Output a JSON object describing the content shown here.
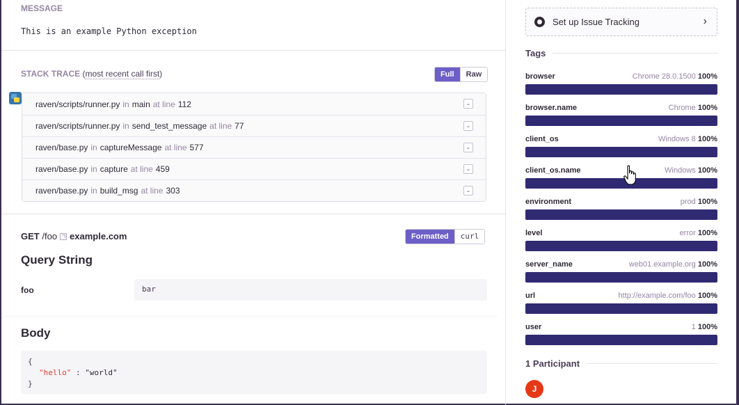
{
  "message": {
    "title": "MESSAGE",
    "text": "This is an example Python exception"
  },
  "stacktrace": {
    "title": "STACK TRACE",
    "subtitle": "most recent call first",
    "toggle": [
      "Full",
      "Raw"
    ],
    "active_toggle": "Full",
    "platform_icon": "python-icon",
    "frames": [
      {
        "file": "raven/scripts/runner.py",
        "in": "in",
        "func": "main",
        "at": "at line",
        "line": "112"
      },
      {
        "file": "raven/scripts/runner.py",
        "in": "in",
        "func": "send_test_message",
        "at": "at line",
        "line": "77"
      },
      {
        "file": "raven/base.py",
        "in": "in",
        "func": "captureMessage",
        "at": "at line",
        "line": "577"
      },
      {
        "file": "raven/base.py",
        "in": "in",
        "func": "capture",
        "at": "at line",
        "line": "459"
      },
      {
        "file": "raven/base.py",
        "in": "in",
        "func": "build_msg",
        "at": "at line",
        "line": "303"
      }
    ]
  },
  "request": {
    "method": "GET",
    "path": "/foo",
    "host": "example.com",
    "toggle": [
      "Formatted",
      "curl"
    ],
    "active_toggle": "Formatted",
    "query_title": "Query String",
    "query": [
      {
        "key": "foo",
        "value": "bar"
      }
    ],
    "body_title": "Body",
    "body": {
      "open": "{",
      "key": "\"hello\"",
      "sep": " : ",
      "value": "\"world\"",
      "close": "}"
    }
  },
  "sidebar": {
    "issue_tracking": "Set up Issue Tracking",
    "tags_title": "Tags",
    "tags": [
      {
        "name": "browser",
        "value": "Chrome 28.0.1500",
        "pct": "100%",
        "fraction": 1.0
      },
      {
        "name": "browser.name",
        "value": "Chrome",
        "pct": "100%",
        "fraction": 1.0
      },
      {
        "name": "client_os",
        "value": "Windows 8",
        "pct": "100%",
        "fraction": 1.0
      },
      {
        "name": "client_os.name",
        "value": "Windows",
        "pct": "100%",
        "fraction": 1.0
      },
      {
        "name": "environment",
        "value": "prod",
        "pct": "100%",
        "fraction": 1.0
      },
      {
        "name": "level",
        "value": "error",
        "pct": "100%",
        "fraction": 1.0
      },
      {
        "name": "server_name",
        "value": "web01.example.org",
        "pct": "100%",
        "fraction": 1.0
      },
      {
        "name": "url",
        "value": "http://example.com/foo",
        "pct": "100%",
        "fraction": 1.0
      },
      {
        "name": "user",
        "value": "1",
        "pct": "100%",
        "fraction": 1.0
      }
    ],
    "participants_title": "1 Participant",
    "participant_initial": "J"
  },
  "colors": {
    "accent": "#6c5fc7",
    "tag_bar": "#302a72",
    "avatar": "#e63717"
  }
}
